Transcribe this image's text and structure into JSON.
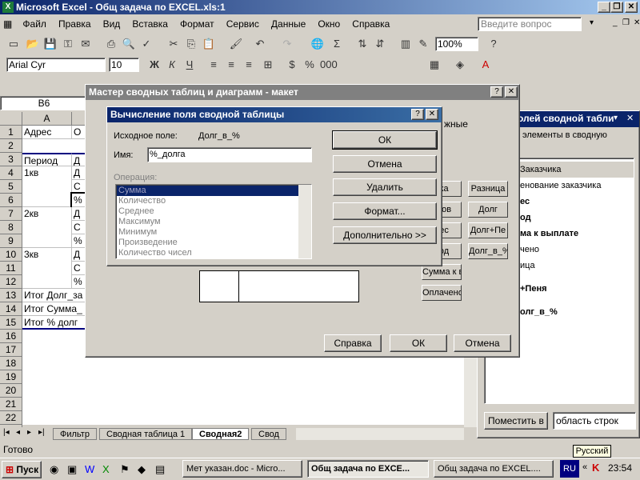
{
  "app": {
    "title": "Microsoft Excel - Общ задача по EXCEL.xls:1",
    "help_placeholder": "Введите вопрос"
  },
  "menu": [
    "Файл",
    "Правка",
    "Вид",
    "Вставка",
    "Формат",
    "Сервис",
    "Данные",
    "Окно",
    "Справка"
  ],
  "formatting": {
    "font": "Arial Cyr",
    "size": "10",
    "zoom": "100%"
  },
  "namebox": "B6",
  "grid": {
    "cols": [
      "A"
    ],
    "rows": [
      "1",
      "2",
      "3",
      "4",
      "5",
      "6",
      "7",
      "8",
      "9",
      "10",
      "11",
      "12",
      "13",
      "14",
      "15",
      "16",
      "17",
      "18",
      "19",
      "20",
      "21",
      "22",
      "23"
    ],
    "cells": {
      "a1": "Адрес",
      "b1": "О",
      "a3": "Период",
      "b3": "Д",
      "a4": "1кв",
      "b4": "Д",
      "b5": "С",
      "b6": "%",
      "a7": "2кв",
      "b7": "Д",
      "b8": "С",
      "b9": "%",
      "a10": "3кв",
      "b10": "Д",
      "b11": "С",
      "b12": "%",
      "a13": "Итог Долг_за",
      "a14": "Итог Сумма_",
      "a15": "Итог % долг"
    }
  },
  "wizard": {
    "title": "Мастер сводных таблиц и диаграмм - макет",
    "text_fragment": "жные",
    "field_buttons": [
      "ака",
      "Разница",
      "енов",
      "Долг",
      "рес",
      "Долг+Пе",
      "иод",
      "Долг_в_%",
      "Сумма к в",
      "Оплачено"
    ],
    "help": "Справка",
    "ok": "ОК",
    "cancel": "Отмена"
  },
  "calc_dialog": {
    "title": "Вычисление поля сводной таблицы",
    "source_label": "Исходное поле:",
    "source_value": "Долг_в_%",
    "name_label": "Имя:",
    "name_value": "%_долга",
    "operation_label": "Операция:",
    "operations": [
      "Сумма",
      "Количество",
      "Среднее",
      "Максимум",
      "Минимум",
      "Произведение",
      "Количество чисел"
    ],
    "ok": "ОК",
    "cancel": "Отмена",
    "delete": "Удалить",
    "format": "Формат...",
    "more": "Дополнительно >>"
  },
  "pivot_panel": {
    "title": "олей сводной табли",
    "hint": "элементы в сводную",
    "fields": [
      "Заказчика",
      "енование заказчика",
      "ес",
      "од",
      "ма к выплате",
      "чено",
      "ица",
      "+Пеня",
      "олг_в_%"
    ],
    "place_button": "Поместить в",
    "area_select": "область строк"
  },
  "sheets": [
    "Фильтр",
    "Сводная таблица 1",
    "Сводная2",
    "Свод"
  ],
  "status": "Готово",
  "tooltip": "Русский",
  "taskbar": {
    "start": "Пуск",
    "tasks": [
      "Мет указан.doc - Micro...",
      "Общ задача по EXCE...",
      "Общ задача по EXCEL...."
    ],
    "lang": "RU",
    "clock": "23:54"
  }
}
